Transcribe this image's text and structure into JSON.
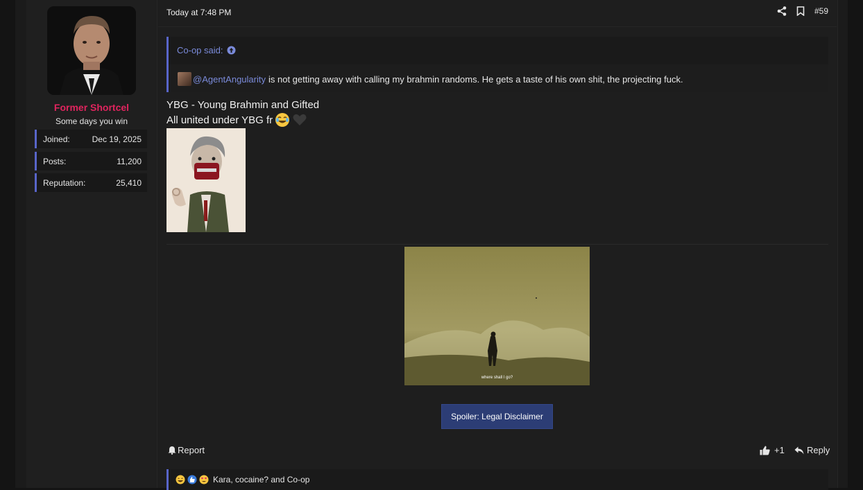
{
  "post": {
    "date": "Today at 7:48 PM",
    "number": "#59"
  },
  "user": {
    "name": "Former Shortcel",
    "title": "Some days you win",
    "stats": [
      {
        "label": "Joined:",
        "value": "Dec 19, 2025"
      },
      {
        "label": "Posts:",
        "value": "11,200"
      },
      {
        "label": "Reputation:",
        "value": "25,410"
      }
    ]
  },
  "quote": {
    "author": "Co-op said:",
    "mention": "@AgentAngularity",
    "text": "is not getting away with calling my brahmin randoms. He gets a taste of his own shit, the projecting fuck."
  },
  "body": {
    "line1": "YBG - Young Brahmin and Gifted",
    "line2": "All united under YBG fr",
    "gif_caption": "where shall I go?",
    "spoiler_label": "Spoiler: Legal Disclaimer"
  },
  "actions": {
    "report": "Report",
    "like_count": "+1",
    "reply": "Reply"
  },
  "reactions": {
    "users": "Kara, cocaine? and Co-op"
  },
  "colors": {
    "accent": "#5865c9",
    "username": "#e0245e",
    "link": "#7a8ad9",
    "spoiler_bg": "#2c3d75"
  }
}
